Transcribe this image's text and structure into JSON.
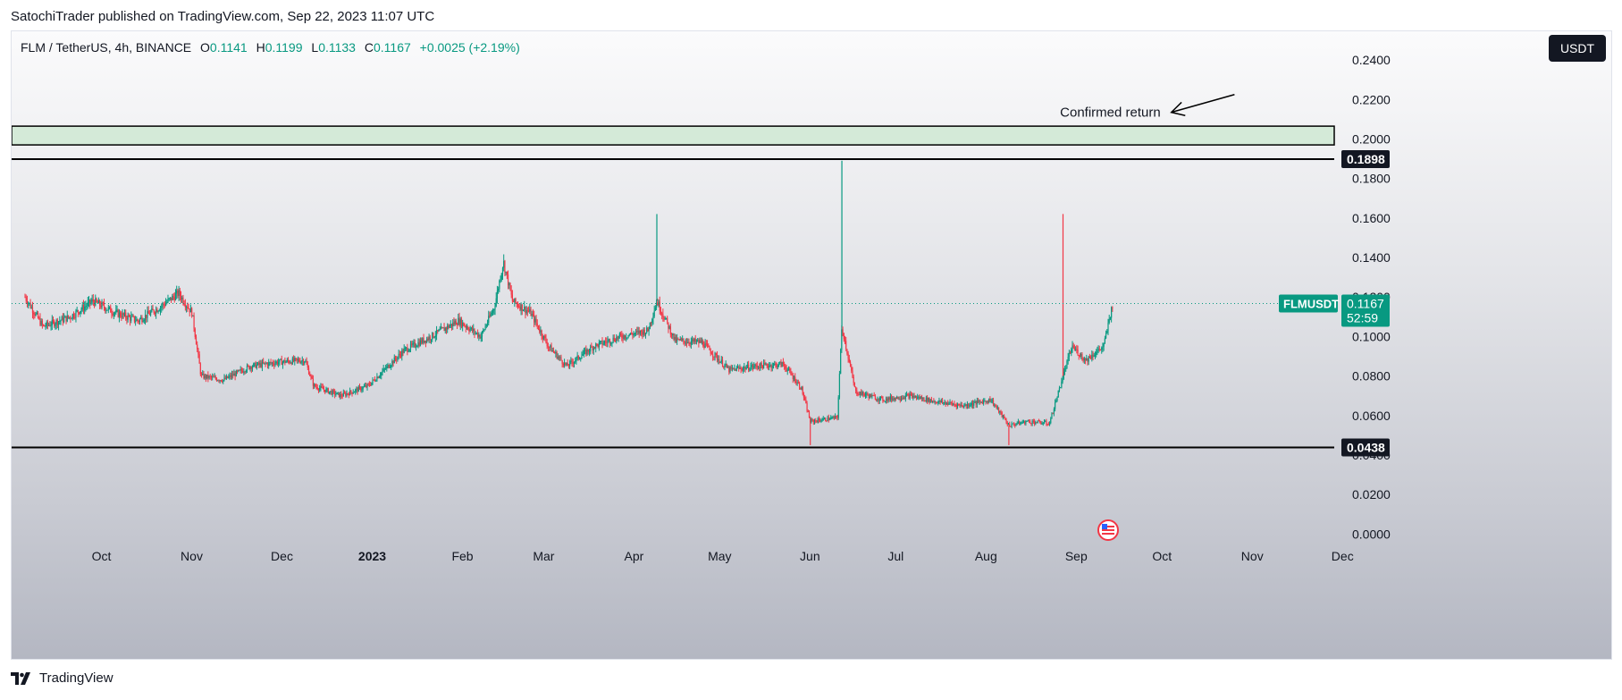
{
  "header": {
    "publisher_line": "SatochiTrader published on TradingView.com, Sep 22, 2023 11:07 UTC"
  },
  "legend": {
    "symbol_line": "FLM / TetherUS, 4h, BINANCE",
    "open_label": "O",
    "open": "0.1141",
    "high_label": "H",
    "high": "0.1199",
    "low_label": "L",
    "low": "0.1133",
    "close_label": "C",
    "close": "0.1167",
    "change": "+0.0025 (+2.19%)"
  },
  "unit_button": {
    "label": "USDT"
  },
  "footer": {
    "brand": "TradingView"
  },
  "colors": {
    "up": "#089981",
    "down": "#f23645",
    "zone_fill": "#d4ead8",
    "line": "#000000",
    "label_bg": "#131722"
  },
  "chart_data": {
    "type": "candlestick",
    "symbol": "FLMUSDT",
    "timeframe": "4h",
    "last_price": 0.1167,
    "price_label": "0.1167",
    "countdown": "52:59",
    "symbol_tag": "FLMUSDT",
    "ylim": [
      -0.008,
      0.25
    ],
    "y_ticks": [
      "0.2400",
      "0.2200",
      "0.2000",
      "0.1800",
      "0.1600",
      "0.1400",
      "0.1200",
      "0.1000",
      "0.0800",
      "0.0600",
      "0.0400",
      "0.0200",
      "0.0000"
    ],
    "x_ticks": [
      {
        "label": "Oct",
        "t": 0.5
      },
      {
        "label": "Nov",
        "t": 1.5
      },
      {
        "label": "Dec",
        "t": 2.5
      },
      {
        "label": "2023",
        "t": 3.5,
        "bold": true
      },
      {
        "label": "Feb",
        "t": 4.5
      },
      {
        "label": "Mar",
        "t": 5.4
      },
      {
        "label": "Apr",
        "t": 6.4
      },
      {
        "label": "May",
        "t": 7.35
      },
      {
        "label": "Jun",
        "t": 8.35
      },
      {
        "label": "Jul",
        "t": 9.3
      },
      {
        "label": "Aug",
        "t": 10.3
      },
      {
        "label": "Sep",
        "t": 11.3
      },
      {
        "label": "Oct",
        "t": 12.25
      },
      {
        "label": "Nov",
        "t": 13.25
      },
      {
        "label": "Dec",
        "t": 14.25
      }
    ],
    "horizontal_lines": [
      {
        "price": 0.1898,
        "label": "0.1898"
      },
      {
        "price": 0.0438,
        "label": "0.0438"
      }
    ],
    "zone": {
      "from": 0.197,
      "to": 0.2065
    },
    "annotation": {
      "text": "Confirmed return",
      "arrow_from": [
        13.4,
        0.2225
      ],
      "arrow_to": [
        12.7,
        0.2135
      ]
    },
    "series": [
      {
        "t": 0.0,
        "p": 0.12
      },
      {
        "t": 0.2,
        "p": 0.105
      },
      {
        "t": 0.5,
        "p": 0.11
      },
      {
        "t": 0.75,
        "p": 0.118
      },
      {
        "t": 1.0,
        "p": 0.112
      },
      {
        "t": 1.25,
        "p": 0.108
      },
      {
        "t": 1.5,
        "p": 0.115
      },
      {
        "t": 1.7,
        "p": 0.122
      },
      {
        "t": 1.85,
        "p": 0.112
      },
      {
        "t": 1.95,
        "p": 0.08
      },
      {
        "t": 2.2,
        "p": 0.078
      },
      {
        "t": 2.5,
        "p": 0.085
      },
      {
        "t": 2.8,
        "p": 0.087
      },
      {
        "t": 3.1,
        "p": 0.088
      },
      {
        "t": 3.2,
        "p": 0.075
      },
      {
        "t": 3.5,
        "p": 0.07
      },
      {
        "t": 3.8,
        "p": 0.075
      },
      {
        "t": 4.2,
        "p": 0.093
      },
      {
        "t": 4.5,
        "p": 0.1
      },
      {
        "t": 4.8,
        "p": 0.108
      },
      {
        "t": 5.05,
        "p": 0.1
      },
      {
        "t": 5.2,
        "p": 0.115
      },
      {
        "t": 5.3,
        "p": 0.138
      },
      {
        "t": 5.4,
        "p": 0.118
      },
      {
        "t": 5.6,
        "p": 0.112
      },
      {
        "t": 5.8,
        "p": 0.095
      },
      {
        "t": 6.0,
        "p": 0.085
      },
      {
        "t": 6.3,
        "p": 0.095
      },
      {
        "t": 6.6,
        "p": 0.1
      },
      {
        "t": 6.9,
        "p": 0.103
      },
      {
        "t": 7.0,
        "p": 0.118
      },
      {
        "t": 7.2,
        "p": 0.098
      },
      {
        "t": 7.5,
        "p": 0.097
      },
      {
        "t": 7.8,
        "p": 0.083
      },
      {
        "t": 8.1,
        "p": 0.085
      },
      {
        "t": 8.4,
        "p": 0.086
      },
      {
        "t": 8.6,
        "p": 0.074
      },
      {
        "t": 8.7,
        "p": 0.057
      },
      {
        "t": 9.0,
        "p": 0.059
      },
      {
        "t": 9.05,
        "p": 0.105
      },
      {
        "t": 9.2,
        "p": 0.072
      },
      {
        "t": 9.5,
        "p": 0.068
      },
      {
        "t": 9.8,
        "p": 0.07
      },
      {
        "t": 10.1,
        "p": 0.067
      },
      {
        "t": 10.4,
        "p": 0.065
      },
      {
        "t": 10.7,
        "p": 0.068
      },
      {
        "t": 10.9,
        "p": 0.055
      },
      {
        "t": 11.1,
        "p": 0.057
      },
      {
        "t": 11.35,
        "p": 0.056
      },
      {
        "t": 11.5,
        "p": 0.08
      },
      {
        "t": 11.6,
        "p": 0.095
      },
      {
        "t": 11.75,
        "p": 0.088
      },
      {
        "t": 11.95,
        "p": 0.095
      },
      {
        "t": 12.05,
        "p": 0.1167
      }
    ],
    "spikes": [
      {
        "t": 7.0,
        "high": 0.162,
        "color": "up"
      },
      {
        "t": 9.05,
        "high": 0.189,
        "color": "up"
      },
      {
        "t": 8.7,
        "low": 0.045,
        "color": "down"
      },
      {
        "t": 10.9,
        "low": 0.045,
        "color": "down"
      },
      {
        "t": 11.5,
        "high": 0.162,
        "color": "down"
      }
    ]
  }
}
